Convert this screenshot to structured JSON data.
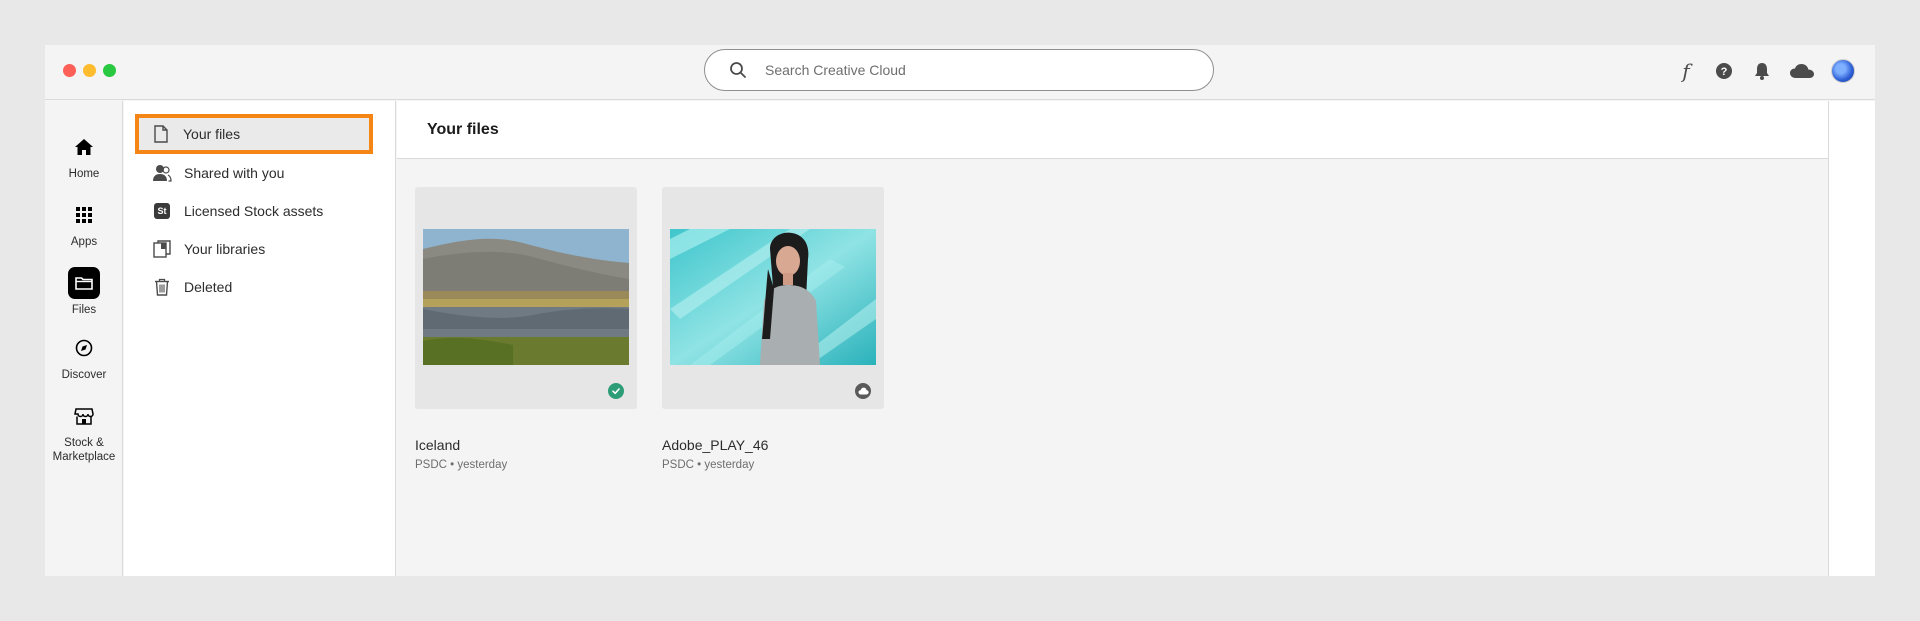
{
  "search": {
    "placeholder": "Search Creative Cloud"
  },
  "top_icons": [
    "fonts-icon",
    "help-icon",
    "notifications-icon",
    "cloud-icon",
    "avatar"
  ],
  "rail": {
    "items": [
      {
        "label": "Home",
        "icon": "home-icon"
      },
      {
        "label": "Apps",
        "icon": "apps-grid-icon"
      },
      {
        "label": "Files",
        "icon": "folder-icon",
        "active": true
      },
      {
        "label": "Discover",
        "icon": "compass-icon"
      },
      {
        "label": "Stock & Marketplace",
        "icon": "store-icon"
      }
    ]
  },
  "nav": {
    "items": [
      {
        "label": "Your files",
        "icon": "file-icon",
        "active": true
      },
      {
        "label": "Shared with you",
        "icon": "shared-users-icon"
      },
      {
        "label": "Licensed Stock assets",
        "icon": "stock-icon",
        "badge": "St"
      },
      {
        "label": "Your libraries",
        "icon": "libraries-icon"
      },
      {
        "label": "Deleted",
        "icon": "trash-icon"
      }
    ]
  },
  "main": {
    "title": "Your files",
    "files": [
      {
        "name": "Iceland",
        "meta": "PSDC • yesterday",
        "status": "synced"
      },
      {
        "name": "Adobe_PLAY_46",
        "meta": "PSDC • yesterday",
        "status": "cloud"
      }
    ]
  },
  "colors": {
    "highlight": "#f58515",
    "synced": "#2d9d78"
  }
}
